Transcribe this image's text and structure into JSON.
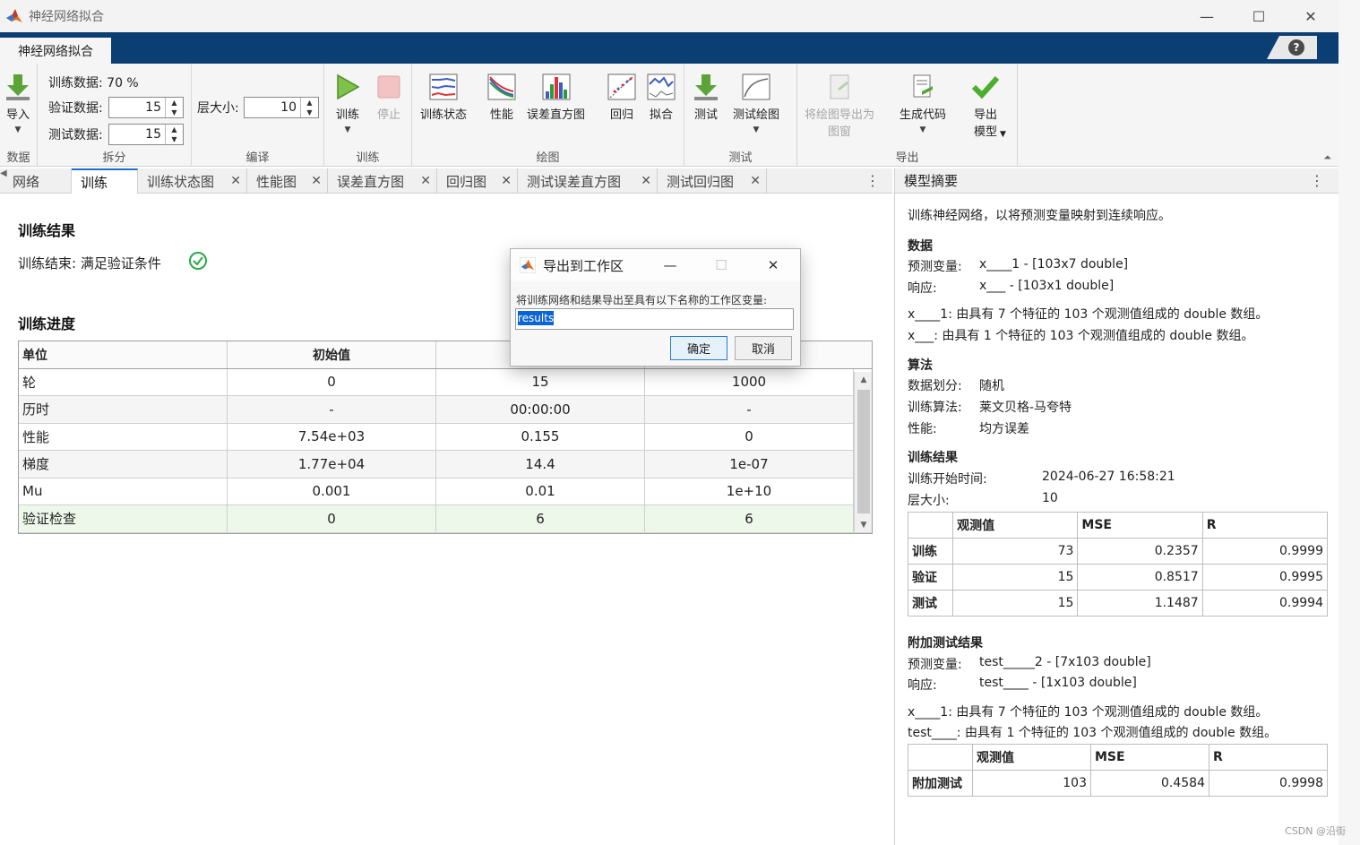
{
  "window": {
    "title": "神经网络拟合",
    "app_tab": "神经网络拟合",
    "help": "?"
  },
  "toolstrip": {
    "data_group": {
      "label": "数据",
      "import_label": "导入"
    },
    "split_group": {
      "label": "拆分",
      "train_label": "训练数据: 70 %",
      "val_label": "验证数据:",
      "val_value": "15",
      "test_label": "测试数据:",
      "test_value": "15"
    },
    "compile_group": {
      "label": "编译",
      "layer_label": "层大小:",
      "layer_value": "10"
    },
    "train_group": {
      "label": "训练",
      "train_btn": "训练",
      "stop_btn": "停止"
    },
    "plot_group": {
      "label": "绘图",
      "items": [
        "训练状态",
        "性能",
        "误差直方图",
        "回归",
        "拟合"
      ]
    },
    "test_group": {
      "label": "测试",
      "items": [
        "测试",
        "测试绘图"
      ]
    },
    "export_group": {
      "label": "导出",
      "export_figure": "将绘图导出为\n图窗",
      "gen_code": "生成代码",
      "export_model": "导出\n模型"
    }
  },
  "tabs": [
    "网络",
    "训练",
    "训练状态图",
    "性能图",
    "误差直方图",
    "回归图",
    "测试误差直方图",
    "测试回归图"
  ],
  "main": {
    "result_heading": "训练结果",
    "result_text": "训练结束: 满足验证条件",
    "progress_heading": "训练进度",
    "table": {
      "headers": [
        "单位",
        "初始值",
        "",
        ""
      ],
      "rows": [
        [
          "轮",
          "0",
          "15",
          "1000"
        ],
        [
          "历时",
          "-",
          "00:00:00",
          "-"
        ],
        [
          "性能",
          "7.54e+03",
          "0.155",
          "0"
        ],
        [
          "梯度",
          "1.77e+04",
          "14.4",
          "1e-07"
        ],
        [
          "Mu",
          "0.001",
          "0.01",
          "1e+10"
        ],
        [
          "验证检查",
          "0",
          "6",
          "6"
        ]
      ]
    }
  },
  "summary": {
    "title": "模型摘要",
    "intro": "训练神经网络，以将预测变量映射到连续响应。",
    "data_heading": "数据",
    "pred_label": "预测变量:",
    "pred_value": "x____1 - [103x7 double]",
    "resp_label": "响应:",
    "resp_value": "x___ - [103x1 double]",
    "note1": "x____1: 由具有 7 个特征的 103 个观测值组成的 double 数组。",
    "note2": "x___: 由具有 1 个特征的 103 个观测值组成的 double 数组。",
    "algo_heading": "算法",
    "split_label": "数据划分:",
    "split_value": "随机",
    "trainalg_label": "训练算法:",
    "trainalg_value": "莱文贝格-马夸特",
    "perf_label": "性能:",
    "perf_value": "均方误差",
    "res_heading": "训练结果",
    "start_label": "训练开始时间:",
    "start_value": "2024-06-27 16:58:21",
    "layer_label": "层大小:",
    "layer_value": "10",
    "res_table": {
      "headers": [
        "",
        "观测值",
        "MSE",
        "R"
      ],
      "rows": [
        [
          "训练",
          "73",
          "0.2357",
          "0.9999"
        ],
        [
          "验证",
          "15",
          "0.8517",
          "0.9995"
        ],
        [
          "测试",
          "15",
          "1.1487",
          "0.9994"
        ]
      ]
    },
    "extra_heading": "附加测试结果",
    "extra_pred_label": "预测变量:",
    "extra_pred_value": "test_____2 - [7x103 double]",
    "extra_resp_label": "响应:",
    "extra_resp_value": "test____ - [1x103 double]",
    "extra_note1": "x____1: 由具有 7 个特征的 103 个观测值组成的 double 数组。",
    "extra_note2": "test____: 由具有 1 个特征的 103 个观测值组成的 double 数组。",
    "extra_table": {
      "headers": [
        "",
        "观测值",
        "MSE",
        "R"
      ],
      "rows": [
        [
          "附加测试",
          "103",
          "0.4584",
          "0.9998"
        ]
      ]
    }
  },
  "dialog": {
    "title": "导出到工作区",
    "message": "将训练网络和结果导出至具有以下名称的工作区变量:",
    "input_value": "results",
    "ok": "确定",
    "cancel": "取消"
  },
  "watermark": "CSDN @沿街",
  "colors": {
    "ribbon": "#0b3e73",
    "accent": "#1f6fd0",
    "success": "#2aa84a"
  }
}
